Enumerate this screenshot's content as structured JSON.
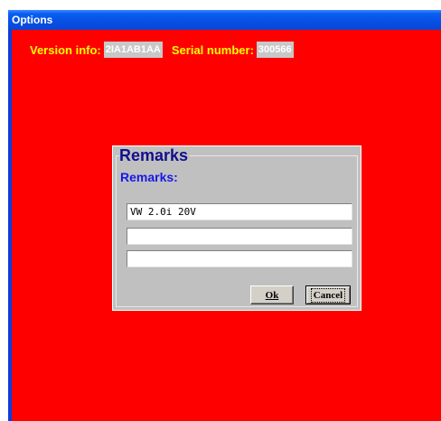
{
  "window": {
    "title": "Options"
  },
  "info": {
    "version_label": "Version info:",
    "version_value": "2IA1AB1AA",
    "serial_label": "Serial number:",
    "serial_value": "300566"
  },
  "dialog": {
    "title": "Remarks",
    "remarks_label": "Remarks:",
    "fields": [
      "VW 2.0i 20V",
      "",
      ""
    ],
    "ok_label": "Ok",
    "cancel_label": "Cancel"
  },
  "colors": {
    "client_background": "#ff0000",
    "info_label": "#ffff00",
    "dialog_background": "#c0c0c0",
    "dialog_title": "#10108c",
    "remarks_label": "#1818e8",
    "titlebar": "#0651e6"
  }
}
